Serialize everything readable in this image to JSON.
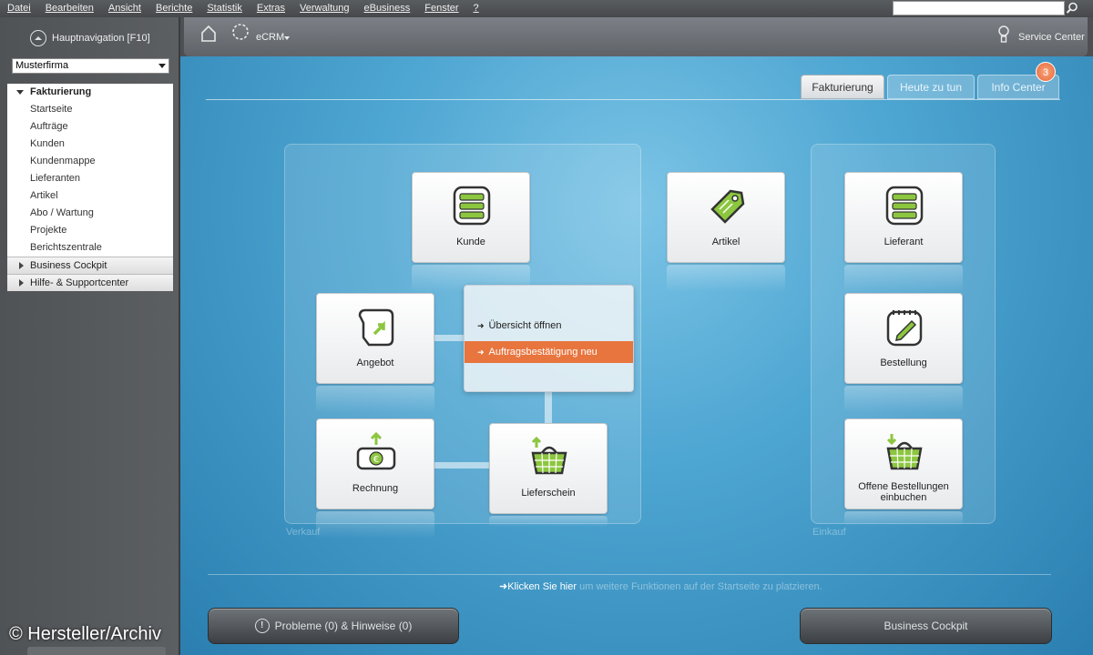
{
  "menu": [
    "Datei",
    "Bearbeiten",
    "Ansicht",
    "Berichte",
    "Statistik",
    "Extras",
    "Verwaltung",
    "eBusiness",
    "Fenster",
    "?"
  ],
  "sidebar": {
    "hauptnav_label": "Hauptnavigation [F10]",
    "company": "Musterfirma",
    "group_open": "Fakturierung",
    "items": [
      "Startseite",
      "Aufträge",
      "Kunden",
      "Kundenmappe",
      "Lieferanten",
      "Artikel",
      "Abo / Wartung",
      "Projekte",
      "Berichtszentrale"
    ],
    "groups_closed": [
      "Business Cockpit",
      "Hilfe- & Supportcenter"
    ]
  },
  "topbar": {
    "module": "eCRM",
    "service": "Service Center"
  },
  "tabs": [
    "Fakturierung",
    "Heute zu tun",
    "Info Center"
  ],
  "info_badge": "3",
  "panels": {
    "left_label": "Verkauf",
    "right_label": "Einkauf"
  },
  "tiles": {
    "kunde": "Kunde",
    "artikel": "Artikel",
    "lieferant": "Lieferant",
    "angebot": "Angebot",
    "bestellung": "Bestellung",
    "rechnung": "Rechnung",
    "lieferschein": "Lieferschein",
    "offene_line1": "Offene Bestellungen",
    "offene_line2": "einbuchen"
  },
  "popup": {
    "option1": "Übersicht öffnen",
    "option2": "Auftragsbestätigung neu"
  },
  "hint": {
    "link": "Klicken Sie hier",
    "rest": " um weitere Funktionen auf der Startseite zu platzieren."
  },
  "buttons": {
    "probleme": "Probleme (0) & Hinweise (0)",
    "cockpit": "Business Cockpit"
  },
  "watermark": "© Hersteller/Archiv",
  "colors": {
    "accent_orange": "#e8753e",
    "main_blue": "#4ea6d2",
    "tile_icon_green": "#8cc63f"
  }
}
